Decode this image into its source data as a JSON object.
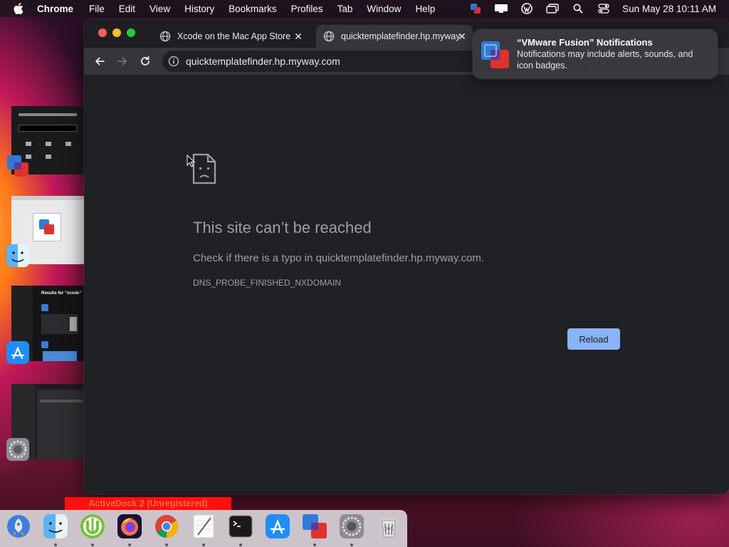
{
  "menubar": {
    "app_name": "Chrome",
    "menus": [
      "File",
      "Edit",
      "View",
      "History",
      "Bookmarks",
      "Profiles",
      "Tab",
      "Window",
      "Help"
    ],
    "clock": "Sun May 28  10:11 AM",
    "status_icons": [
      "vmware-icon",
      "display-icon",
      "wordpress-icon",
      "window-icon",
      "search-icon",
      "control-center-icon"
    ]
  },
  "tabs": [
    {
      "title": "Xcode on the Mac App Store",
      "icon": "globe-icon"
    },
    {
      "title": "quicktemplatefinder.hp.myway.com",
      "icon": "globe-icon"
    }
  ],
  "omnibox": {
    "url": "quicktemplatefinder.hp.myway.com"
  },
  "error_page": {
    "title": "This site can’t be reached",
    "description": "Check if there is a typo in quicktemplatefinder.hp.myway.com.",
    "code": "DNS_PROBE_FINISHED_NXDOMAIN",
    "reload_label": "Reload"
  },
  "notification": {
    "title": "“VMware Fusion” Notifications",
    "body": "Notifications may include alerts, sounds, and icon badges."
  },
  "thumbnails": {
    "th3_caption": "Results for “xcode”"
  },
  "activedock_banner": "ActiveDock 2 (Unregistered)",
  "dock": {
    "items": [
      "launchpad-icon",
      "finder-icon",
      "utorrent-icon",
      "firefox-icon",
      "chrome-icon",
      "textedit-icon",
      "terminal-icon",
      "app-store-icon",
      "vmware-fusion-icon",
      "system-preferences-icon",
      "trash-icon"
    ]
  },
  "colors": {
    "accent": "#8ab4f8",
    "page_bg": "#202124",
    "text_muted": "#9aa0a6",
    "banner_red": "#ff1010"
  }
}
